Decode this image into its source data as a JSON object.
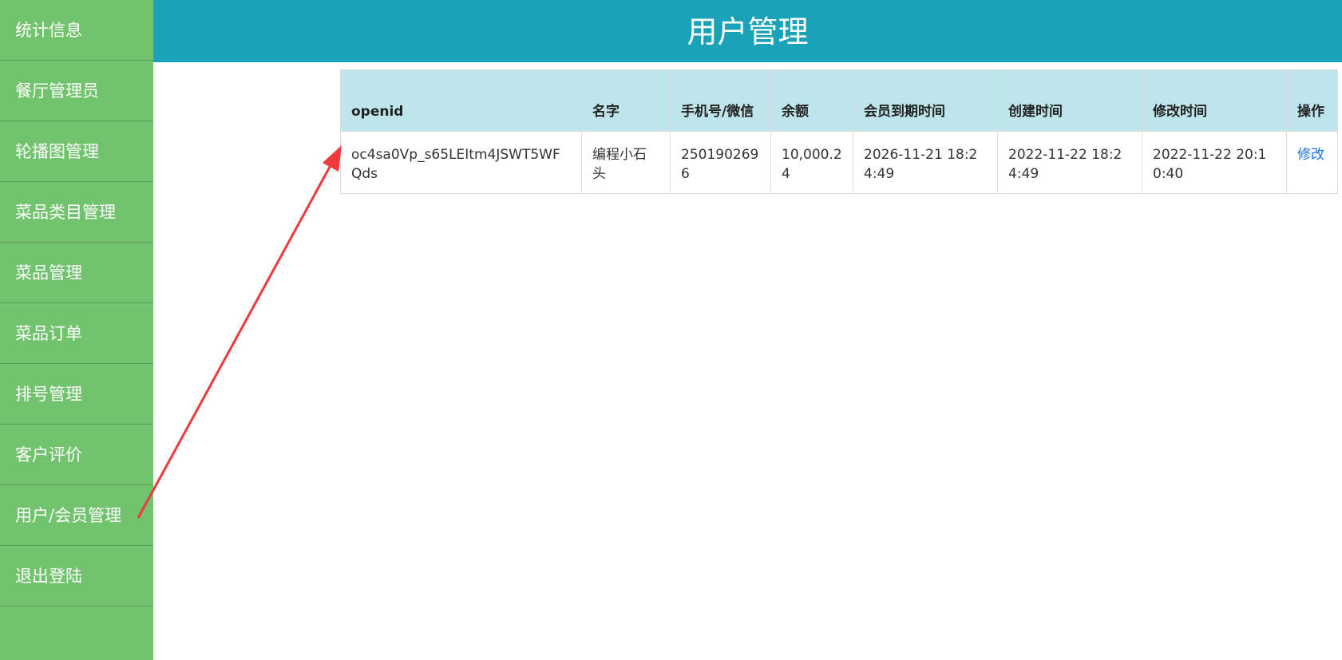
{
  "sidebar": {
    "items": [
      {
        "label": "统计信息"
      },
      {
        "label": "餐厅管理员"
      },
      {
        "label": "轮播图管理"
      },
      {
        "label": "菜品类目管理"
      },
      {
        "label": "菜品管理"
      },
      {
        "label": "菜品订单"
      },
      {
        "label": "排号管理"
      },
      {
        "label": "客户评价"
      },
      {
        "label": "用户/会员管理"
      },
      {
        "label": "退出登陆"
      }
    ]
  },
  "header": {
    "title": "用户管理"
  },
  "table": {
    "columns": [
      "openid",
      "名字",
      "手机号/微信",
      "余额",
      "会员到期时间",
      "创建时间",
      "修改时间",
      "操作"
    ],
    "rows": [
      {
        "openid": "oc4sa0Vp_s65LEItm4JSWT5WFQds",
        "name": "编程小石头",
        "phone": "2501902696",
        "balance": "10,000.24",
        "member_expire": "2026-11-21 18:24:49",
        "created": "2022-11-22 18:24:49",
        "modified": "2022-11-22 20:10:40",
        "action": "修改"
      }
    ]
  },
  "colors": {
    "sidebar_bg": "#72c36d",
    "header_bg": "#1aa3b8",
    "table_header_bg": "#bfe5ec",
    "link": "#1a73e8",
    "annotation_arrow": "#f0393a"
  }
}
